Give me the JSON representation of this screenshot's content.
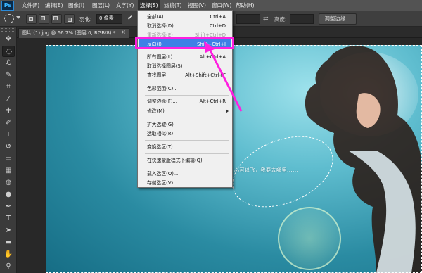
{
  "app": {
    "logo_text": "Ps"
  },
  "menubar": {
    "items": [
      {
        "label": "文件(F)"
      },
      {
        "label": "编辑(E)"
      },
      {
        "label": "图像(I)"
      },
      {
        "label": "图层(L)"
      },
      {
        "label": "文字(Y)"
      },
      {
        "label": "选择(S)"
      },
      {
        "label": "滤镜(T)"
      },
      {
        "label": "视图(V)"
      },
      {
        "label": "窗口(W)"
      },
      {
        "label": "帮助(H)"
      }
    ],
    "active_index": 5
  },
  "options_bar": {
    "feather_label": "羽化:",
    "feather_value": "0 像素",
    "antialias_checked": "✔",
    "height_label": "高度:",
    "refine_edge_button": "调整边缘..."
  },
  "document": {
    "tab_title": "图片 (1).jpg @ 66.7% (图层 0, RGB/8) *",
    "close_glyph": "×",
    "canvas_text": "心可以飞，我要去哪里......"
  },
  "select_menu": {
    "items": [
      {
        "label": "全部(A)",
        "shortcut": "Ctrl+A",
        "disabled": false
      },
      {
        "label": "取消选择(D)",
        "shortcut": "Ctrl+D",
        "disabled": false
      },
      {
        "label": "重新选择(E)",
        "shortcut": "Shift+Ctrl+D",
        "disabled": true
      },
      {
        "label": "反向(I)",
        "shortcut": "Shift+Ctrl+I",
        "disabled": false,
        "highlighted": true
      },
      {
        "label": "所有图层(L)",
        "shortcut": "Alt+Ctrl+A",
        "disabled": false
      },
      {
        "label": "取消选择图层(S)",
        "shortcut": "",
        "disabled": false
      },
      {
        "label": "查找图层",
        "shortcut": "Alt+Shift+Ctrl+F",
        "disabled": false
      },
      {
        "label": "色彩范围(C)...",
        "shortcut": "",
        "disabled": false
      },
      {
        "label": "调整边缘(F)...",
        "shortcut": "Alt+Ctrl+R",
        "disabled": false
      },
      {
        "label": "修改(M)",
        "shortcut": "",
        "disabled": false,
        "submenu": true
      },
      {
        "label": "扩大选取(G)",
        "shortcut": "",
        "disabled": false
      },
      {
        "label": "选取相似(R)",
        "shortcut": "",
        "disabled": false
      },
      {
        "label": "变换选区(T)",
        "shortcut": "",
        "disabled": false
      },
      {
        "label": "在快速蒙版模式下编辑(Q)",
        "shortcut": "",
        "disabled": false
      },
      {
        "label": "载入选区(O)...",
        "shortcut": "",
        "disabled": false
      },
      {
        "label": "存储选区(V)...",
        "shortcut": "",
        "disabled": false
      }
    ]
  },
  "toolbox": {
    "tools": [
      {
        "name": "move-tool",
        "glyph": "✥"
      },
      {
        "name": "marquee-tool",
        "glyph": "◌"
      },
      {
        "name": "lasso-tool",
        "glyph": "ℒ"
      },
      {
        "name": "quick-select-tool",
        "glyph": "✎"
      },
      {
        "name": "crop-tool",
        "glyph": "⌗"
      },
      {
        "name": "eyedropper-tool",
        "glyph": "⁄"
      },
      {
        "name": "healing-brush-tool",
        "glyph": "✚"
      },
      {
        "name": "brush-tool",
        "glyph": "✐"
      },
      {
        "name": "clone-stamp-tool",
        "glyph": "⊥"
      },
      {
        "name": "history-brush-tool",
        "glyph": "↺"
      },
      {
        "name": "eraser-tool",
        "glyph": "▭"
      },
      {
        "name": "gradient-tool",
        "glyph": "▦"
      },
      {
        "name": "blur-tool",
        "glyph": "◍"
      },
      {
        "name": "dodge-tool",
        "glyph": "●"
      },
      {
        "name": "pen-tool",
        "glyph": "✒"
      },
      {
        "name": "type-tool",
        "glyph": "T"
      },
      {
        "name": "path-select-tool",
        "glyph": "➤"
      },
      {
        "name": "shape-tool",
        "glyph": "▬"
      },
      {
        "name": "hand-tool",
        "glyph": "✋"
      },
      {
        "name": "zoom-tool",
        "glyph": "⚲"
      }
    ],
    "active_index": 1
  },
  "colors": {
    "menu_highlight": "#3e80e6",
    "annotation": "#ff1fe0",
    "ps_blue": "#39b4ff"
  }
}
